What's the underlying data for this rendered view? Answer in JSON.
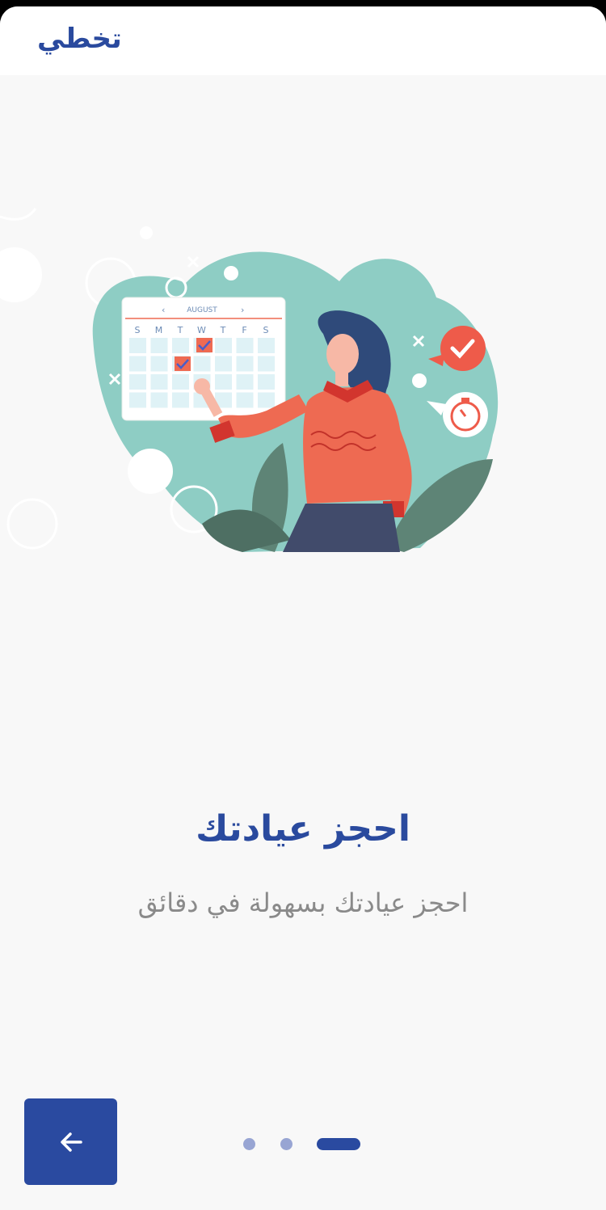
{
  "topbar": {
    "skip_label": "تخطي"
  },
  "illustration": {
    "calendar_month": "AUGUST",
    "weekdays": [
      "S",
      "M",
      "T",
      "W",
      "T",
      "F",
      "S"
    ],
    "name": "woman-booking-calendar-illustration"
  },
  "onboarding": {
    "title": "احجز عيادتك",
    "subtitle": "احجز عيادتك بسهولة في دقائق"
  },
  "pagination": {
    "total": 3,
    "active_index": 2
  },
  "nav_button": {
    "icon": "arrow-left-icon"
  },
  "colors": {
    "brand_blue": "#2a4aa0",
    "dot_inactive": "#98a5d3",
    "teal_blob": "#8ecdc4",
    "accent_red": "#ee6a52",
    "subtitle_gray": "#8a8a8a"
  }
}
